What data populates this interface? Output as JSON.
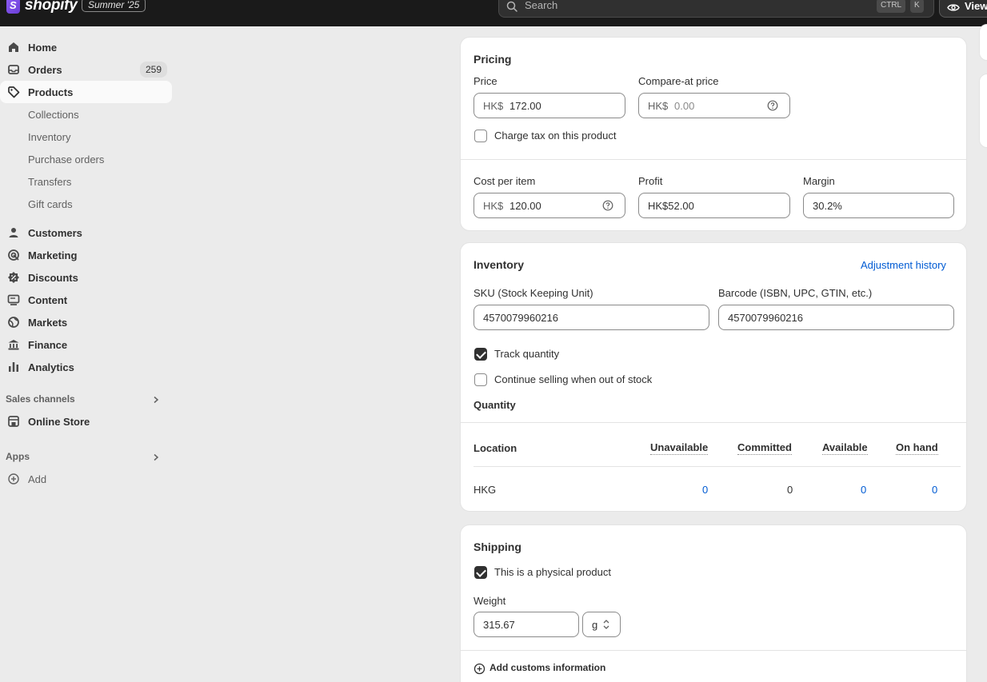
{
  "topbar": {
    "logo_text": "shopify",
    "edition_badge": "Summer '25",
    "search_placeholder": "Search",
    "shortcut_ctrl": "CTRL",
    "shortcut_k": "K",
    "view_label": "View"
  },
  "sidebar": {
    "items": [
      {
        "label": "Home",
        "icon": "home-icon"
      },
      {
        "label": "Orders",
        "icon": "inbox-icon",
        "count": "259"
      },
      {
        "label": "Products",
        "icon": "tag-icon",
        "active": true
      },
      {
        "label": "Collections"
      },
      {
        "label": "Inventory"
      },
      {
        "label": "Purchase orders"
      },
      {
        "label": "Transfers"
      },
      {
        "label": "Gift cards"
      },
      {
        "label": "Customers",
        "icon": "person-icon"
      },
      {
        "label": "Marketing",
        "icon": "target-icon"
      },
      {
        "label": "Discounts",
        "icon": "discount-icon"
      },
      {
        "label": "Content",
        "icon": "content-icon"
      },
      {
        "label": "Markets",
        "icon": "globe-icon"
      },
      {
        "label": "Finance",
        "icon": "bank-icon"
      },
      {
        "label": "Analytics",
        "icon": "bar-chart-icon"
      }
    ],
    "sales_channels_label": "Sales channels",
    "online_store_label": "Online Store",
    "apps_label": "Apps",
    "add_label": "Add"
  },
  "pricing": {
    "title": "Pricing",
    "price_label": "Price",
    "price_prefix": "HK$",
    "price_value": "172.00",
    "compare_label": "Compare-at price",
    "compare_prefix": "HK$",
    "compare_placeholder": "0.00",
    "charge_tax_label": "Charge tax on this product",
    "charge_tax_checked": false,
    "cost_label": "Cost per item",
    "cost_prefix": "HK$",
    "cost_value": "120.00",
    "profit_label": "Profit",
    "profit_value": "HK$52.00",
    "margin_label": "Margin",
    "margin_value": "30.2%"
  },
  "inventory": {
    "title": "Inventory",
    "adjustment_link": "Adjustment history",
    "sku_label": "SKU (Stock Keeping Unit)",
    "sku_value": "4570079960216",
    "barcode_label": "Barcode (ISBN, UPC, GTIN, etc.)",
    "barcode_value": "4570079960216",
    "track_quantity_label": "Track quantity",
    "track_quantity_checked": true,
    "continue_selling_label": "Continue selling when out of stock",
    "continue_selling_checked": false,
    "quantity_heading": "Quantity",
    "table": {
      "headers": [
        "Location",
        "Unavailable",
        "Committed",
        "Available",
        "On hand"
      ],
      "rows": [
        {
          "location": "HKG",
          "unavailable": "0",
          "committed": "0",
          "available": "0",
          "on_hand": "0"
        }
      ]
    }
  },
  "shipping": {
    "title": "Shipping",
    "physical_label": "This is a physical product",
    "physical_checked": true,
    "weight_label": "Weight",
    "weight_value": "315.67",
    "weight_unit": "g",
    "customs_label": "Add customs information"
  },
  "colors": {
    "accent_link": "#005bd3",
    "topbar_bg": "#1a1a1a",
    "page_bg": "#ebebeb"
  }
}
